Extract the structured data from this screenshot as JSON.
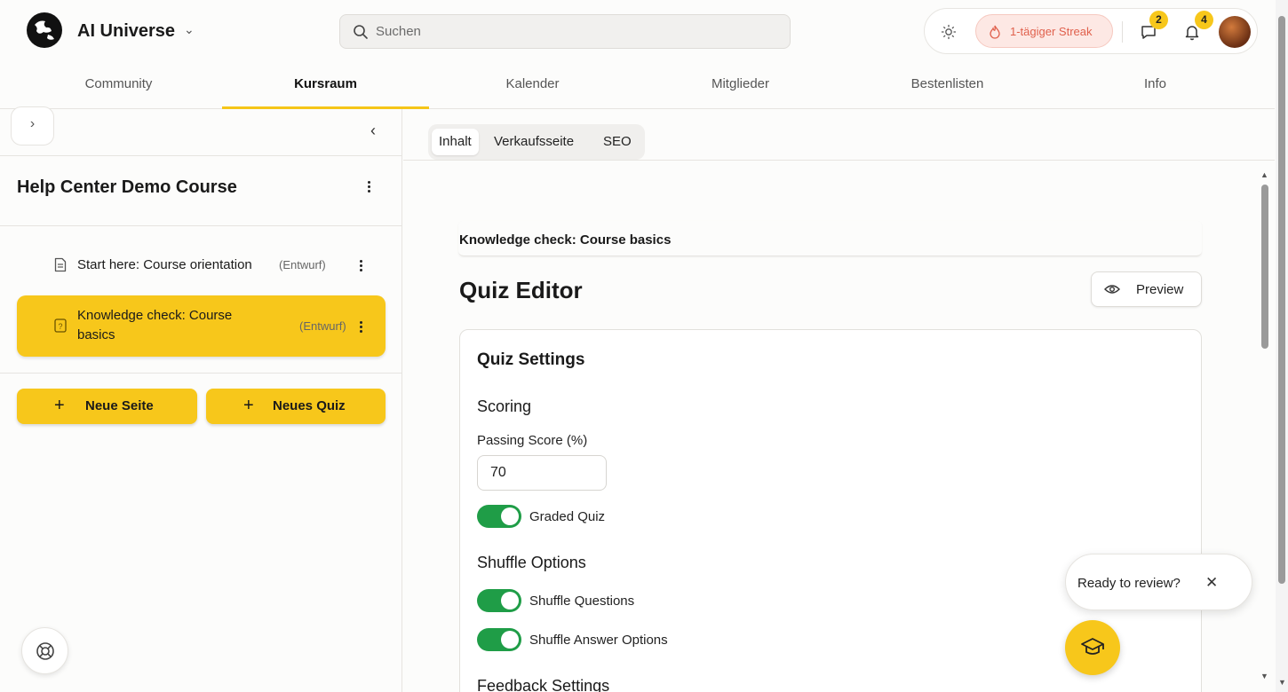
{
  "header": {
    "brand": "AI Universe",
    "search_placeholder": "Suchen",
    "streak_label": "1-tägiger Streak",
    "messages_badge": "2",
    "notifications_badge": "4"
  },
  "nav": {
    "tabs": [
      {
        "label": "Community"
      },
      {
        "label": "Kursraum"
      },
      {
        "label": "Kalender"
      },
      {
        "label": "Mitglieder"
      },
      {
        "label": "Bestenlisten"
      },
      {
        "label": "Info"
      }
    ],
    "active": "Kursraum"
  },
  "sidebar": {
    "course_title": "Help Center Demo Course",
    "lessons": [
      {
        "title": "Start here: Course orientation",
        "status": "(Entwurf)",
        "icon": "document-icon"
      },
      {
        "title_line1": "Knowledge check: Course",
        "title_line2": "basics",
        "status": "(Entwurf)",
        "icon": "quiz-icon"
      }
    ],
    "new_page_label": "Neue Seite",
    "new_quiz_label": "Neues Quiz"
  },
  "main": {
    "tabs": [
      {
        "label": "Inhalt"
      },
      {
        "label": "Verkaufsseite"
      },
      {
        "label": "SEO"
      }
    ],
    "active_tab": "Inhalt",
    "breadcrumb_title": "Knowledge check: Course basics",
    "editor_title": "Quiz Editor",
    "preview_label": "Preview",
    "settings": {
      "title": "Quiz Settings",
      "scoring_title": "Scoring",
      "passing_score_label": "Passing Score (%)",
      "passing_score_value": "70",
      "graded_quiz_label": "Graded Quiz",
      "graded_quiz_on": true,
      "shuffle_title": "Shuffle Options",
      "shuffle_questions_label": "Shuffle Questions",
      "shuffle_questions_on": true,
      "shuffle_answers_label": "Shuffle Answer Options",
      "shuffle_answers_on": true,
      "feedback_title": "Feedback Settings"
    }
  },
  "review_popup": {
    "text": "Ready to review?"
  },
  "colors": {
    "accent": "#f7c71b",
    "toggle_on": "#1f9d47",
    "streak_text": "#e0604c",
    "streak_bg": "#fde8e4"
  }
}
